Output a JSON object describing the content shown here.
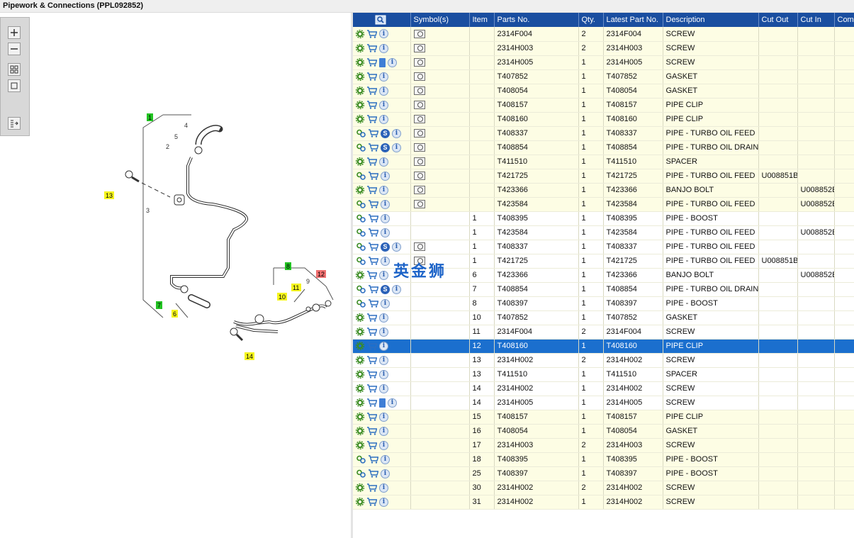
{
  "title": "Pipework & Connections (PPL092852)",
  "watermark": "英金狮",
  "columns": [
    "",
    "Symbol(s)",
    "Item",
    "Parts No.",
    "Qty.",
    "Latest Part No.",
    "Description",
    "Cut Out",
    "Cut In",
    "Comment"
  ],
  "rows": [
    {
      "icons": [
        "gear",
        "cart",
        "info"
      ],
      "sym": true,
      "item": "",
      "part": "2314F004",
      "qty": "2",
      "latest": "2314F004",
      "desc": "SCREW",
      "cutout": "",
      "cutin": "",
      "comment": "",
      "shade": "y"
    },
    {
      "icons": [
        "gear",
        "cart",
        "info"
      ],
      "sym": true,
      "item": "",
      "part": "2314H003",
      "qty": "2",
      "latest": "2314H003",
      "desc": "SCREW",
      "cutout": "",
      "cutin": "",
      "comment": "",
      "shade": "y"
    },
    {
      "icons": [
        "gear",
        "cart",
        "doc",
        "info"
      ],
      "sym": true,
      "item": "",
      "part": "2314H005",
      "qty": "1",
      "latest": "2314H005",
      "desc": "SCREW",
      "cutout": "",
      "cutin": "",
      "comment": "",
      "shade": "y"
    },
    {
      "icons": [
        "gear",
        "cart",
        "info"
      ],
      "sym": true,
      "item": "",
      "part": "T407852",
      "qty": "1",
      "latest": "T407852",
      "desc": "GASKET",
      "cutout": "",
      "cutin": "",
      "comment": "",
      "shade": "y"
    },
    {
      "icons": [
        "gear",
        "cart",
        "info"
      ],
      "sym": true,
      "item": "",
      "part": "T408054",
      "qty": "1",
      "latest": "T408054",
      "desc": "GASKET",
      "cutout": "",
      "cutin": "",
      "comment": "",
      "shade": "y"
    },
    {
      "icons": [
        "gear",
        "cart",
        "info"
      ],
      "sym": true,
      "item": "",
      "part": "T408157",
      "qty": "1",
      "latest": "T408157",
      "desc": "PIPE CLIP",
      "cutout": "",
      "cutin": "",
      "comment": "",
      "shade": "y"
    },
    {
      "icons": [
        "gear",
        "cart",
        "info"
      ],
      "sym": true,
      "item": "",
      "part": "T408160",
      "qty": "1",
      "latest": "T408160",
      "desc": "PIPE CLIP",
      "cutout": "",
      "cutin": "",
      "comment": "",
      "shade": "y"
    },
    {
      "icons": [
        "gears",
        "cart",
        "s",
        "info"
      ],
      "sym": true,
      "item": "",
      "part": "T408337",
      "qty": "1",
      "latest": "T408337",
      "desc": "PIPE - TURBO OIL FEED",
      "cutout": "",
      "cutin": "",
      "comment": "",
      "shade": "y"
    },
    {
      "icons": [
        "gears",
        "cart",
        "s",
        "info"
      ],
      "sym": true,
      "item": "",
      "part": "T408854",
      "qty": "1",
      "latest": "T408854",
      "desc": "PIPE - TURBO OIL DRAIN",
      "cutout": "",
      "cutin": "",
      "comment": "",
      "shade": "y"
    },
    {
      "icons": [
        "gear",
        "cart",
        "info"
      ],
      "sym": true,
      "item": "",
      "part": "T411510",
      "qty": "1",
      "latest": "T411510",
      "desc": "SPACER",
      "cutout": "",
      "cutin": "",
      "comment": "",
      "shade": "y"
    },
    {
      "icons": [
        "gears",
        "cart",
        "info"
      ],
      "sym": true,
      "item": "",
      "part": "T421725",
      "qty": "1",
      "latest": "T421725",
      "desc": "PIPE - TURBO OIL FEED",
      "cutout": "U008851B",
      "cutin": "",
      "comment": "",
      "shade": "y"
    },
    {
      "icons": [
        "gear",
        "cart",
        "info"
      ],
      "sym": true,
      "item": "",
      "part": "T423366",
      "qty": "1",
      "latest": "T423366",
      "desc": "BANJO BOLT",
      "cutout": "",
      "cutin": "U008852E",
      "comment": "",
      "shade": "y"
    },
    {
      "icons": [
        "gears",
        "cart",
        "info"
      ],
      "sym": true,
      "item": "",
      "part": "T423584",
      "qty": "1",
      "latest": "T423584",
      "desc": "PIPE - TURBO OIL FEED",
      "cutout": "",
      "cutin": "U008852E",
      "comment": "",
      "shade": "y"
    },
    {
      "icons": [
        "gears",
        "cart",
        "info"
      ],
      "sym": false,
      "item": "1",
      "part": "T408395",
      "qty": "1",
      "latest": "T408395",
      "desc": "PIPE - BOOST",
      "cutout": "",
      "cutin": "",
      "comment": "",
      "shade": "w"
    },
    {
      "icons": [
        "gears",
        "cart",
        "info"
      ],
      "sym": false,
      "item": "1",
      "part": "T423584",
      "qty": "1",
      "latest": "T423584",
      "desc": "PIPE - TURBO OIL FEED",
      "cutout": "",
      "cutin": "U008852E",
      "comment": "",
      "shade": "w"
    },
    {
      "icons": [
        "gears",
        "cart",
        "s",
        "info"
      ],
      "sym": true,
      "item": "1",
      "part": "T408337",
      "qty": "1",
      "latest": "T408337",
      "desc": "PIPE - TURBO OIL FEED",
      "cutout": "",
      "cutin": "",
      "comment": "",
      "shade": "w"
    },
    {
      "icons": [
        "gears",
        "cart",
        "info"
      ],
      "sym": true,
      "item": "1",
      "part": "T421725",
      "qty": "1",
      "latest": "T421725",
      "desc": "PIPE - TURBO OIL FEED",
      "cutout": "U008851B",
      "cutin": "",
      "comment": "",
      "shade": "w"
    },
    {
      "icons": [
        "gear",
        "cart",
        "info"
      ],
      "sym": false,
      "item": "6",
      "part": "T423366",
      "qty": "1",
      "latest": "T423366",
      "desc": "BANJO BOLT",
      "cutout": "",
      "cutin": "U008852E",
      "comment": "",
      "shade": "w"
    },
    {
      "icons": [
        "gears",
        "cart",
        "s",
        "info"
      ],
      "sym": false,
      "item": "7",
      "part": "T408854",
      "qty": "1",
      "latest": "T408854",
      "desc": "PIPE - TURBO OIL DRAIN",
      "cutout": "",
      "cutin": "",
      "comment": "",
      "shade": "w"
    },
    {
      "icons": [
        "gears",
        "cart",
        "info"
      ],
      "sym": false,
      "item": "8",
      "part": "T408397",
      "qty": "1",
      "latest": "T408397",
      "desc": "PIPE - BOOST",
      "cutout": "",
      "cutin": "",
      "comment": "",
      "shade": "w"
    },
    {
      "icons": [
        "gear",
        "cart",
        "info"
      ],
      "sym": false,
      "item": "10",
      "part": "T407852",
      "qty": "1",
      "latest": "T407852",
      "desc": "GASKET",
      "cutout": "",
      "cutin": "",
      "comment": "",
      "shade": "w"
    },
    {
      "icons": [
        "gear",
        "cart",
        "info"
      ],
      "sym": false,
      "item": "11",
      "part": "2314F004",
      "qty": "2",
      "latest": "2314F004",
      "desc": "SCREW",
      "cutout": "",
      "cutin": "",
      "comment": "",
      "shade": "w"
    },
    {
      "icons": [
        "gear",
        "cart",
        "info"
      ],
      "sym": false,
      "item": "12",
      "part": "T408160",
      "qty": "1",
      "latest": "T408160",
      "desc": "PIPE CLIP",
      "cutout": "",
      "cutin": "",
      "comment": "",
      "shade": "sel"
    },
    {
      "icons": [
        "gear",
        "cart",
        "info"
      ],
      "sym": false,
      "item": "13",
      "part": "2314H002",
      "qty": "2",
      "latest": "2314H002",
      "desc": "SCREW",
      "cutout": "",
      "cutin": "",
      "comment": "",
      "shade": "w"
    },
    {
      "icons": [
        "gear",
        "cart",
        "info"
      ],
      "sym": false,
      "item": "13",
      "part": "T411510",
      "qty": "1",
      "latest": "T411510",
      "desc": "SPACER",
      "cutout": "",
      "cutin": "",
      "comment": "",
      "shade": "w"
    },
    {
      "icons": [
        "gear",
        "cart",
        "info"
      ],
      "sym": false,
      "item": "14",
      "part": "2314H002",
      "qty": "1",
      "latest": "2314H002",
      "desc": "SCREW",
      "cutout": "",
      "cutin": "",
      "comment": "",
      "shade": "w"
    },
    {
      "icons": [
        "gear",
        "cart",
        "doc",
        "info"
      ],
      "sym": false,
      "item": "14",
      "part": "2314H005",
      "qty": "1",
      "latest": "2314H005",
      "desc": "SCREW",
      "cutout": "",
      "cutin": "",
      "comment": "",
      "shade": "w"
    },
    {
      "icons": [
        "gear",
        "cart",
        "info"
      ],
      "sym": false,
      "item": "15",
      "part": "T408157",
      "qty": "1",
      "latest": "T408157",
      "desc": "PIPE CLIP",
      "cutout": "",
      "cutin": "",
      "comment": "",
      "shade": "y"
    },
    {
      "icons": [
        "gear",
        "cart",
        "info"
      ],
      "sym": false,
      "item": "16",
      "part": "T408054",
      "qty": "1",
      "latest": "T408054",
      "desc": "GASKET",
      "cutout": "",
      "cutin": "",
      "comment": "",
      "shade": "y"
    },
    {
      "icons": [
        "gear",
        "cart",
        "info"
      ],
      "sym": false,
      "item": "17",
      "part": "2314H003",
      "qty": "2",
      "latest": "2314H003",
      "desc": "SCREW",
      "cutout": "",
      "cutin": "",
      "comment": "",
      "shade": "y"
    },
    {
      "icons": [
        "gears",
        "cart",
        "info"
      ],
      "sym": false,
      "item": "18",
      "part": "T408395",
      "qty": "1",
      "latest": "T408395",
      "desc": "PIPE - BOOST",
      "cutout": "",
      "cutin": "",
      "comment": "",
      "shade": "y"
    },
    {
      "icons": [
        "gears",
        "cart",
        "info"
      ],
      "sym": false,
      "item": "25",
      "part": "T408397",
      "qty": "1",
      "latest": "T408397",
      "desc": "PIPE - BOOST",
      "cutout": "",
      "cutin": "",
      "comment": "",
      "shade": "y"
    },
    {
      "icons": [
        "gear",
        "cart",
        "info"
      ],
      "sym": false,
      "item": "30",
      "part": "2314H002",
      "qty": "2",
      "latest": "2314H002",
      "desc": "SCREW",
      "cutout": "",
      "cutin": "",
      "comment": "",
      "shade": "y"
    },
    {
      "icons": [
        "gear",
        "cart",
        "info"
      ],
      "sym": false,
      "item": "31",
      "part": "2314H002",
      "qty": "1",
      "latest": "2314H002",
      "desc": "SCREW",
      "cutout": "",
      "cutin": "",
      "comment": "",
      "shade": "y"
    }
  ],
  "diagram": {
    "callouts": [
      {
        "label": "1",
        "color": "#22c322"
      },
      {
        "label": "13",
        "color": "#f5f51e"
      },
      {
        "label": "7",
        "color": "#22c322"
      },
      {
        "label": "6",
        "color": "#f5f51e"
      },
      {
        "label": "8",
        "color": "#22c322"
      },
      {
        "label": "12",
        "color": "#f07070"
      },
      {
        "label": "10",
        "color": "#f5f51e"
      },
      {
        "label": "11",
        "color": "#f5f51e"
      },
      {
        "label": "14",
        "color": "#f5f51e"
      }
    ],
    "plain_labels": [
      "4",
      "5",
      "2",
      "3",
      "9"
    ]
  },
  "icons": {
    "zoom_in": "zoom-in-icon",
    "zoom_out": "zoom-out-icon",
    "grid": "grid-view-icon",
    "fit": "fit-icon",
    "panel": "panel-toggle-icon",
    "find": "find-icon"
  }
}
